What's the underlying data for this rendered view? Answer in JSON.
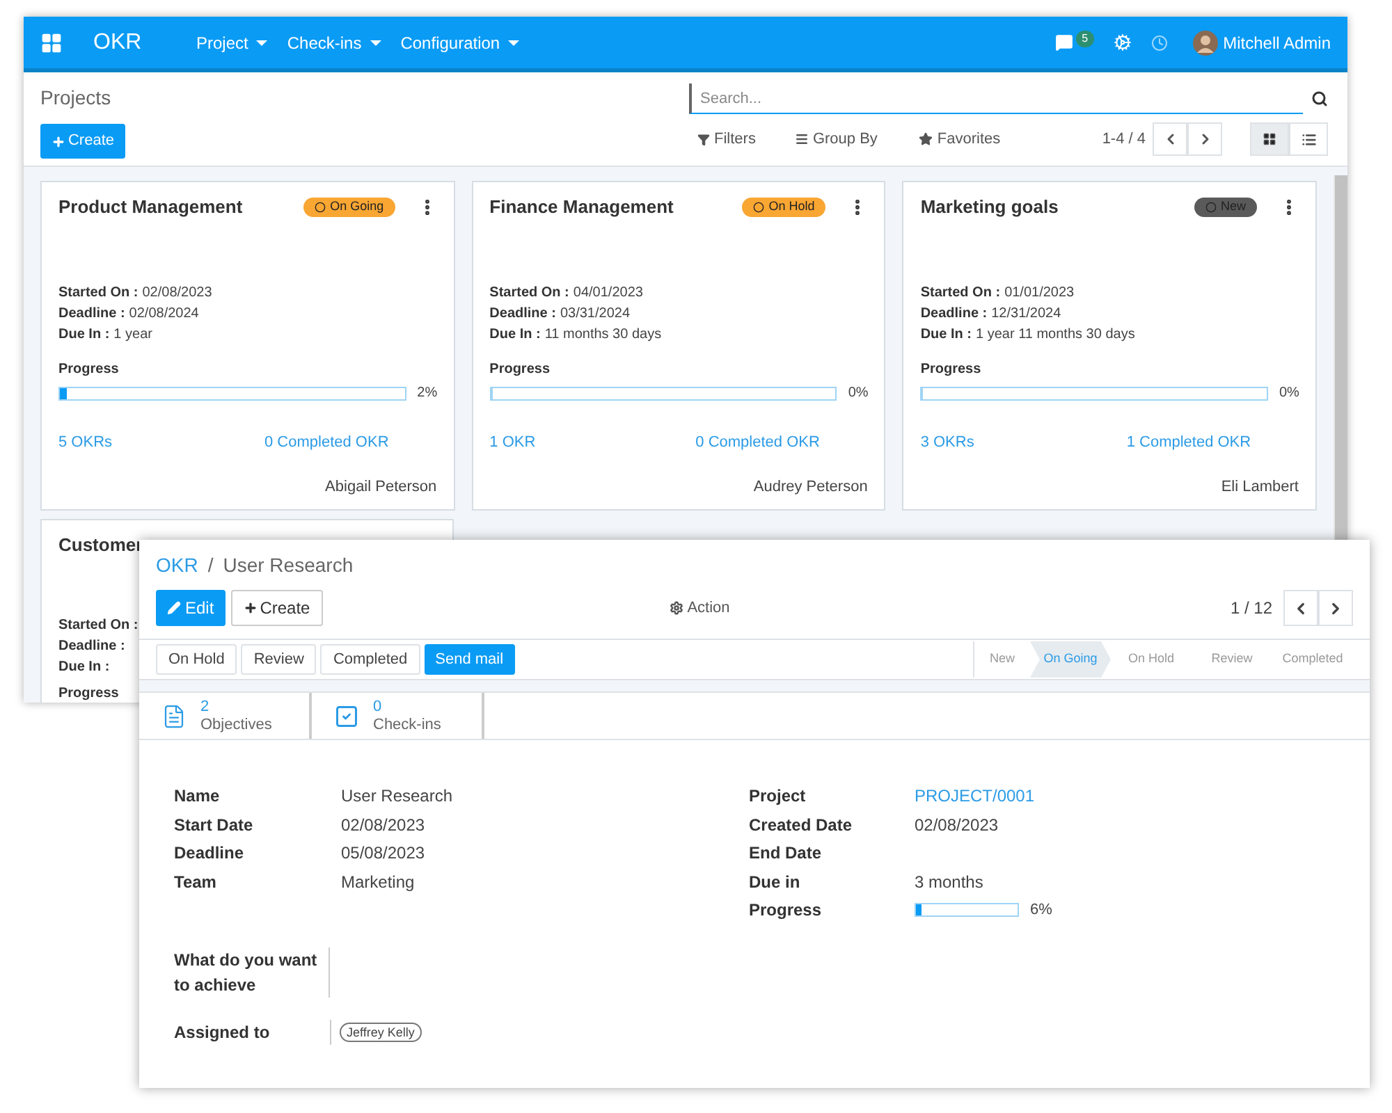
{
  "navbar": {
    "app": "OKR",
    "menus": [
      "Project",
      "Check-ins",
      "Configuration"
    ],
    "messages_count": "5",
    "user": "Mitchell Admin"
  },
  "control_panel": {
    "title": "Projects",
    "create": "Create",
    "search_placeholder": "Search...",
    "filters": "Filters",
    "group_by": "Group By",
    "favorites": "Favorites",
    "pager": "1-4 / 4",
    "views": [
      {
        "kind": "kanban",
        "selected": true
      },
      {
        "kind": "list",
        "selected": false
      }
    ]
  },
  "cards": [
    {
      "title": "Product Management",
      "status": {
        "label": "On Going",
        "color": "#f9a633"
      },
      "fields": [
        {
          "label": "Started On :",
          "value": "02/08/2023"
        },
        {
          "label": "Deadline :",
          "value": "02/08/2024"
        },
        {
          "label": "Due In :",
          "value": "1 year"
        }
      ],
      "progress_label": "Progress",
      "level": 0.02,
      "reading": "2%",
      "okrs": "5 OKRs",
      "completed": "0 Completed OKR",
      "owner": "Abigail Peterson"
    },
    {
      "title": "Finance Management",
      "status": {
        "label": "On Hold",
        "color": "#f9a633"
      },
      "fields": [
        {
          "label": "Started On :",
          "value": "04/01/2023"
        },
        {
          "label": "Deadline :",
          "value": "03/31/2024"
        },
        {
          "label": "Due In :",
          "value": "11 months 30 days"
        }
      ],
      "progress_label": "Progress",
      "level": 0,
      "reading": "0%",
      "okrs": "1 OKR",
      "completed": "0 Completed OKR",
      "owner": "Audrey Peterson"
    },
    {
      "title": "Marketing goals",
      "status": {
        "label": "New",
        "color": "#5a5a5a"
      },
      "fields": [
        {
          "label": "Started On :",
          "value": "01/01/2023"
        },
        {
          "label": "Deadline :",
          "value": "12/31/2024"
        },
        {
          "label": "Due In :",
          "value": "1 year 11 months 30 days"
        }
      ],
      "progress_label": "Progress",
      "level": 0,
      "reading": "0%",
      "okrs": "3 OKRs",
      "completed": "1 Completed OKR",
      "owner": "Eli Lambert"
    }
  ],
  "covered_card": {
    "title": "Customer",
    "fields": [
      {
        "label": "Started On :"
      },
      {
        "label": "Deadline :"
      },
      {
        "label": "Due In :"
      }
    ],
    "progress_label": "Progress"
  },
  "form": {
    "breadcrumb": {
      "parent": "OKR",
      "separator": "/",
      "current": "User Research"
    },
    "edit": "Edit",
    "create": "Create",
    "action": "Action",
    "pager": "1 / 12",
    "header_buttons": [
      {
        "label": "On Hold",
        "primary": false
      },
      {
        "label": "Review",
        "primary": false
      },
      {
        "label": "Completed",
        "primary": false
      },
      {
        "label": "Send mail",
        "primary": true
      }
    ],
    "stages": [
      {
        "label": "New",
        "selected": false
      },
      {
        "label": "On Going",
        "selected": true
      },
      {
        "label": "On Hold",
        "selected": false
      },
      {
        "label": "Review",
        "selected": false
      },
      {
        "label": "Completed",
        "selected": false
      }
    ],
    "smart_buttons": [
      {
        "kind": "objectives",
        "count": "2",
        "label": "Objectives"
      },
      {
        "kind": "checkins",
        "count": "0",
        "label": "Check-ins"
      }
    ],
    "left_fields": [
      {
        "label": "Name",
        "value": "User Research"
      },
      {
        "label": "Start Date",
        "value": "02/08/2023"
      },
      {
        "label": "Deadline",
        "value": "05/08/2023"
      },
      {
        "label": "Team",
        "value": "Marketing"
      }
    ],
    "right_fields": [
      {
        "kind": "link",
        "label": "Project",
        "value": "PROJECT/0001"
      },
      {
        "kind": "text",
        "label": "Created Date",
        "value": "02/08/2023"
      },
      {
        "kind": "text",
        "label": "End Date"
      },
      {
        "kind": "text",
        "label": "Due in",
        "value": "3 months"
      },
      {
        "kind": "progress",
        "label": "Progress",
        "level": 0.06,
        "reading": "6%"
      }
    ],
    "goal_label": "What do you want to achieve",
    "assigned_label": "Assigned to",
    "assignees": [
      "Jeffrey Kelly"
    ]
  }
}
